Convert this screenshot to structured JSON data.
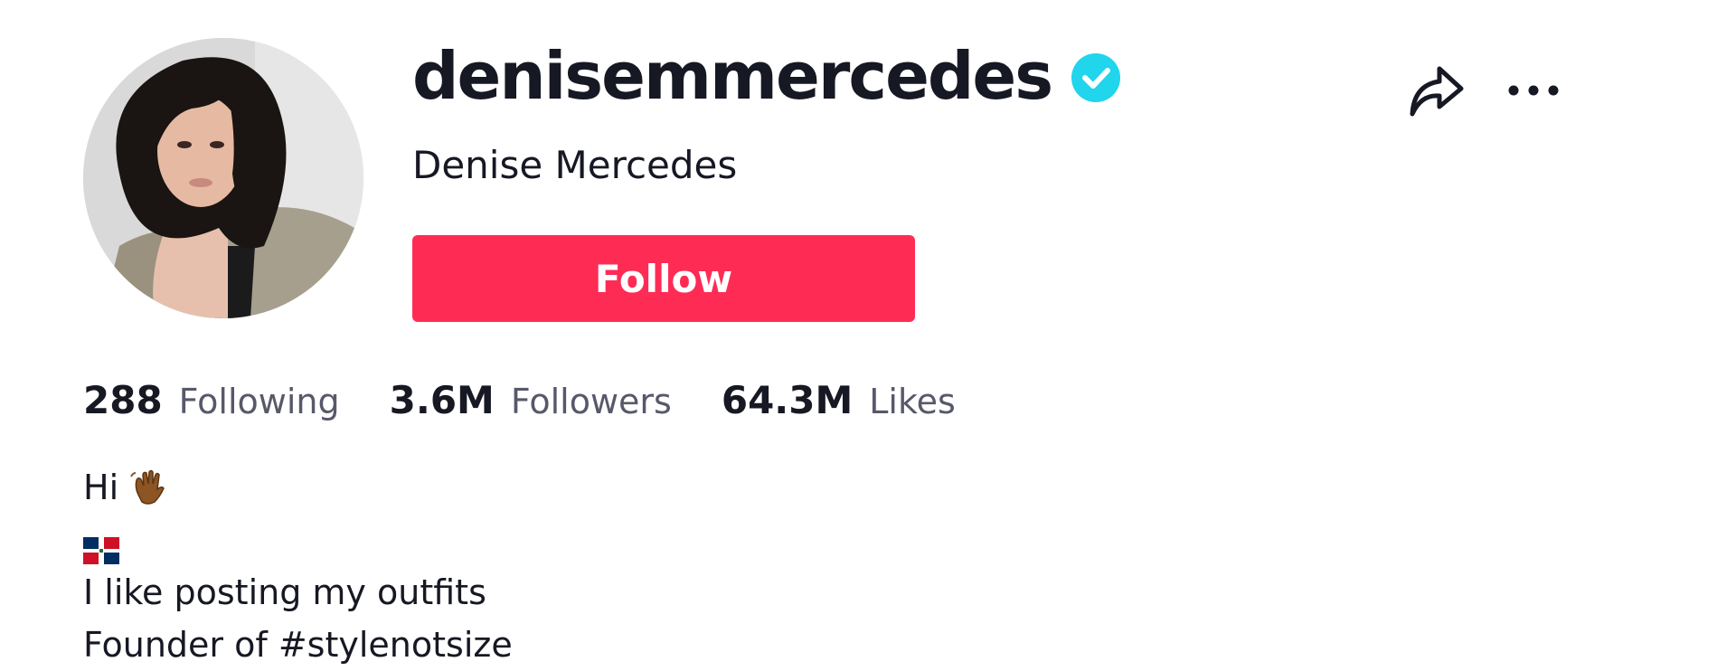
{
  "profile": {
    "username": "denisemmercedes",
    "nickname": "Denise Mercedes",
    "verified": true,
    "follow_label": "Follow",
    "colors": {
      "follow_button": "#fe2c55",
      "verified_badge": "#20d5ec",
      "primary_text": "#161823",
      "secondary_text": "#57586a"
    },
    "icons": {
      "share": "share-arrow-icon",
      "more": "more-options-icon",
      "verified": "verified-check-icon"
    }
  },
  "stats": {
    "following": {
      "value": "288",
      "label": "Following"
    },
    "followers": {
      "value": "3.6M",
      "label": "Followers"
    },
    "likes": {
      "value": "64.3M",
      "label": "Likes"
    }
  },
  "bio": {
    "line1": "Hi",
    "line1_emoji": "waving-hand-emoji",
    "line2_emoji": "dominican-republic-flag-emoji",
    "line3": "I like posting my outfits",
    "line4": "Founder of #stylenotsize"
  }
}
